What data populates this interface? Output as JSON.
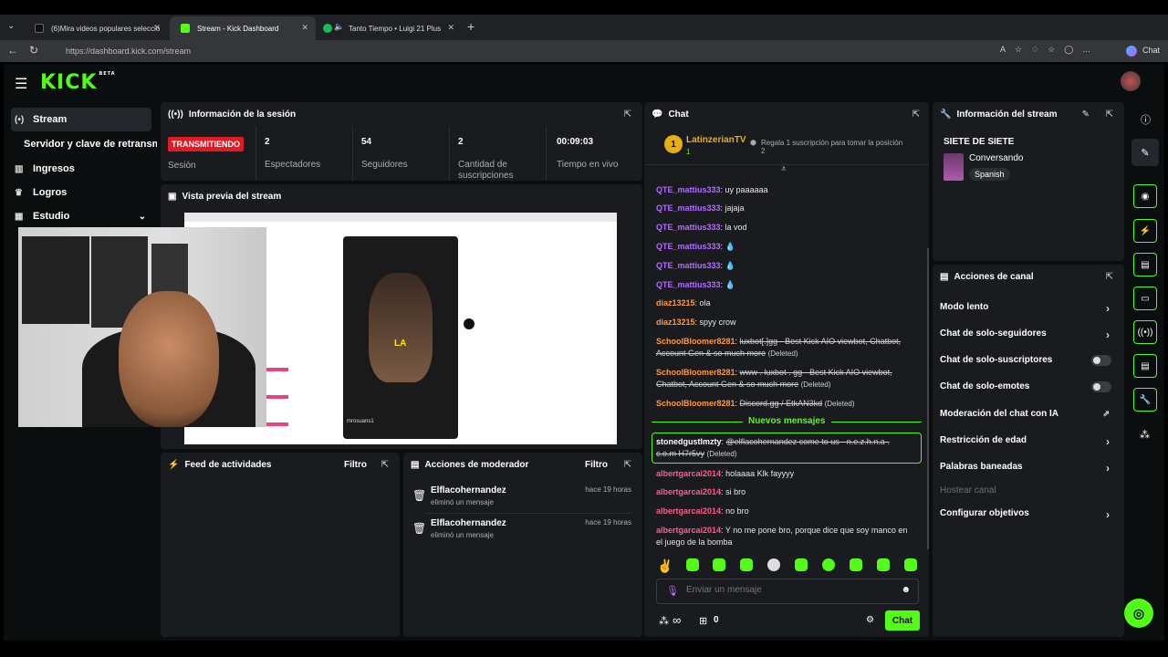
{
  "browser": {
    "tabs": [
      {
        "label": "(6)Mira videos populares seleccio"
      },
      {
        "label": "Stream - Kick Dashboard"
      },
      {
        "label": "Tanto Tiempo • Luigi 21 Plus"
      }
    ],
    "url": "https://dashboard.kick.com/stream",
    "chat_label": "Chat"
  },
  "header": {
    "logo": "KICK",
    "beta": "BETA"
  },
  "sidebar": {
    "items": [
      {
        "label": "Stream",
        "icon": "(•)"
      },
      {
        "label": "Servidor y clave de retransm"
      },
      {
        "label": "Ingresos",
        "icon": "▥"
      },
      {
        "label": "Logros",
        "icon": "♛"
      },
      {
        "label": "Estudio",
        "icon": "▦"
      }
    ]
  },
  "session": {
    "title": "Información de la sesión",
    "status": "TRANSMITIENDO",
    "status_label": "Sesión",
    "stats": [
      {
        "value": "2",
        "label": "Espectadores"
      },
      {
        "value": "54",
        "label": "Seguidores"
      },
      {
        "value": "2",
        "label": "Cantidad de suscripciones"
      },
      {
        "value": "00:09:03",
        "label": "Tiempo en vivo"
      }
    ]
  },
  "preview": {
    "title": "Vista previa del stream",
    "overlay_text": "LA",
    "caption": "mrosuans1"
  },
  "feed": {
    "title": "Feed de actividades",
    "filter": "Filtro"
  },
  "modactions": {
    "title": "Acciones de moderador",
    "filter": "Filtro",
    "items": [
      {
        "user": "Elflacohernandez",
        "action": "eliminó un mensaje",
        "time": "hace 19 horas"
      },
      {
        "user": "Elflacohernandez",
        "action": "eliminó un mensaje",
        "time": "hace 19 horas"
      }
    ]
  },
  "chat": {
    "title": "Chat",
    "top_user": "LatinzerianTV",
    "top_rank": "1",
    "top_count": "1",
    "promo": "Regala 1 suscripción para tomar la posición 2",
    "messages": [
      {
        "user": "QTE_mattius333",
        "text": "uy paaaaaa"
      },
      {
        "user": "QTE_mattius333",
        "text": "jajaja"
      },
      {
        "user": "QTE_mattius333",
        "text": "la vod"
      },
      {
        "user": "QTE_mattius333",
        "text": ""
      },
      {
        "user": "QTE_mattius333",
        "text": ""
      },
      {
        "user": "QTE_mattius333",
        "text": ""
      },
      {
        "user": "diaz13215",
        "text": "ola"
      },
      {
        "user": "diaz13215",
        "text": "spyy crow"
      },
      {
        "user": "SchoolBloomer8281",
        "text": "luxbot[.]gg - Best Kick AIO viewbot, Chatbot, Account Gen & so much more",
        "deleted": "(Deleted)"
      },
      {
        "user": "SchoolBloomer8281",
        "text": "www . luxbot . gg - Best Kick AIO viewbot, Chatbot, Account Gen & so much more",
        "deleted": "(Deleted)"
      },
      {
        "user": "SchoolBloomer8281",
        "text": "Discord.gg / EtkAN3kd",
        "deleted": "(Deleted)"
      }
    ],
    "new_messages": "Nuevos mensajes",
    "highlight": {
      "user": "stonedgustlmzty",
      "text": "@elflacohernandez come to us - n.e.z.h.n.a . c.o.m H7r5vy",
      "deleted": "(Deleted)"
    },
    "messages2": [
      {
        "user": "albertgarcai2014",
        "text": "holaaaa Klk fayyyy"
      },
      {
        "user": "albertgarcai2014",
        "text": "si bro"
      },
      {
        "user": "albertgarcai2014",
        "text": "no bro"
      },
      {
        "user": "albertgarcai2014",
        "text": "Y no me pone bro, porque dice que soy manco en el juego de la bomba"
      }
    ],
    "placeholder": "Enviar un mensaje",
    "infinity": "∞",
    "count": "0",
    "send": "Chat"
  },
  "streaminfo": {
    "title": "Información del stream",
    "stream_title": "SIETE DE SIETE",
    "category": "Conversando",
    "language": "Spanish"
  },
  "channel": {
    "title": "Acciones de canal",
    "items": [
      {
        "label": "Modo lento",
        "control": "chevron"
      },
      {
        "label": "Chat de solo-seguidores",
        "control": "chevron"
      },
      {
        "label": "Chat de solo-suscriptores",
        "control": "toggle"
      },
      {
        "label": "Chat de solo-emotes",
        "control": "toggle"
      },
      {
        "label": "Moderación del chat con IA",
        "control": "external"
      },
      {
        "label": "Restricción de edad",
        "control": "chevron"
      },
      {
        "label": "Palabras baneadas",
        "control": "chevron"
      },
      {
        "label": "Hostear canal",
        "control": "none"
      },
      {
        "label": "Configurar objetivos",
        "control": "chevron"
      }
    ]
  },
  "colors": {
    "accent": "#53fc18",
    "username": "#b36bff",
    "username_alt": "#ff9a3c",
    "danger": "#e01b24"
  }
}
